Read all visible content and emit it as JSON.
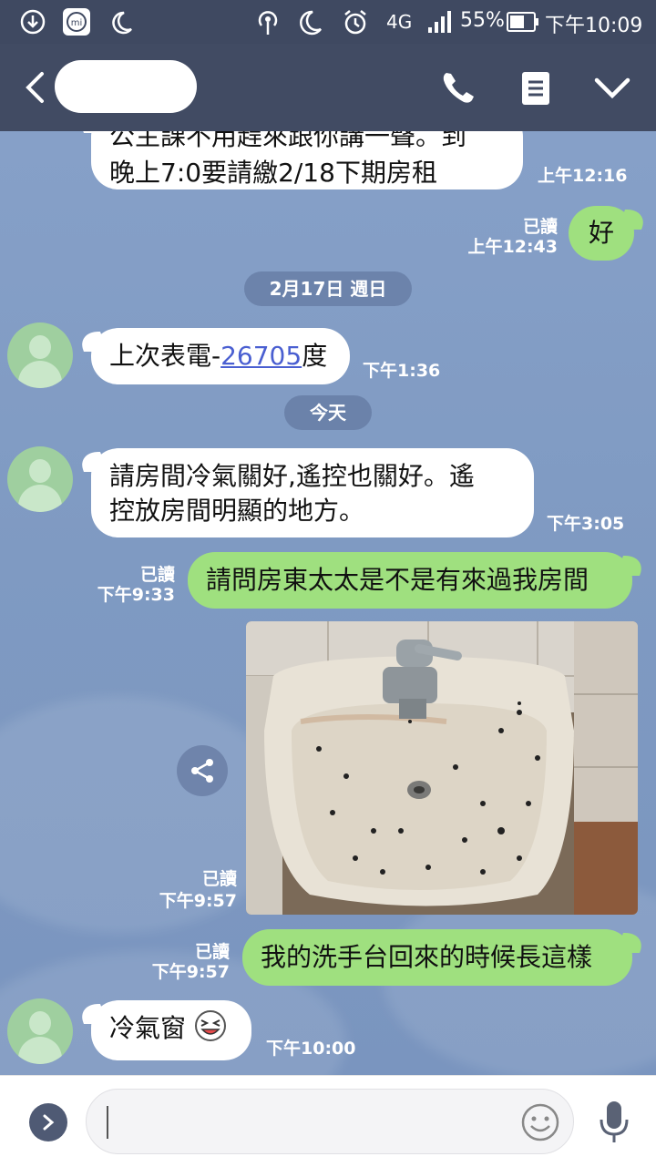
{
  "status_bar": {
    "network": "4G",
    "battery": "55%",
    "time": "下午10:09"
  },
  "header": {
    "contact_name": ""
  },
  "messages": [
    {
      "text_line1": "公主課不用趕來跟你講一聲。到",
      "text_line2": "晚上7:0要請繳2/18下期房租",
      "time": "上午12:16"
    },
    {
      "text": "好",
      "read": "已讀",
      "time": "上午12:43"
    },
    {
      "date": "2月17日 週日"
    },
    {
      "prefix": "上次表電-",
      "link": "26705",
      "suffix": "度",
      "time": "下午1:36"
    },
    {
      "date": "今天"
    },
    {
      "text_line1": "請房間冷氣關好,遙控也關好。遙",
      "text_line2": "控放房間明顯的地方。",
      "time": "下午3:05"
    },
    {
      "text": "請問房東太太是不是有來過我房間",
      "read": "已讀",
      "time": "下午9:33"
    },
    {
      "read": "已讀",
      "time": "下午9:57"
    },
    {
      "text": "我的洗手台回來的時候長這樣",
      "read": "已讀",
      "time": "下午9:57"
    },
    {
      "text": "冷氣窗",
      "emoji": "laughing-emoji",
      "time": "下午10:00"
    }
  ],
  "colors": {
    "header_bg": "#414b63",
    "chat_bg": "#7e97c0",
    "outgoing_bubble": "#9fe07f",
    "incoming_bubble": "#ffffff"
  }
}
